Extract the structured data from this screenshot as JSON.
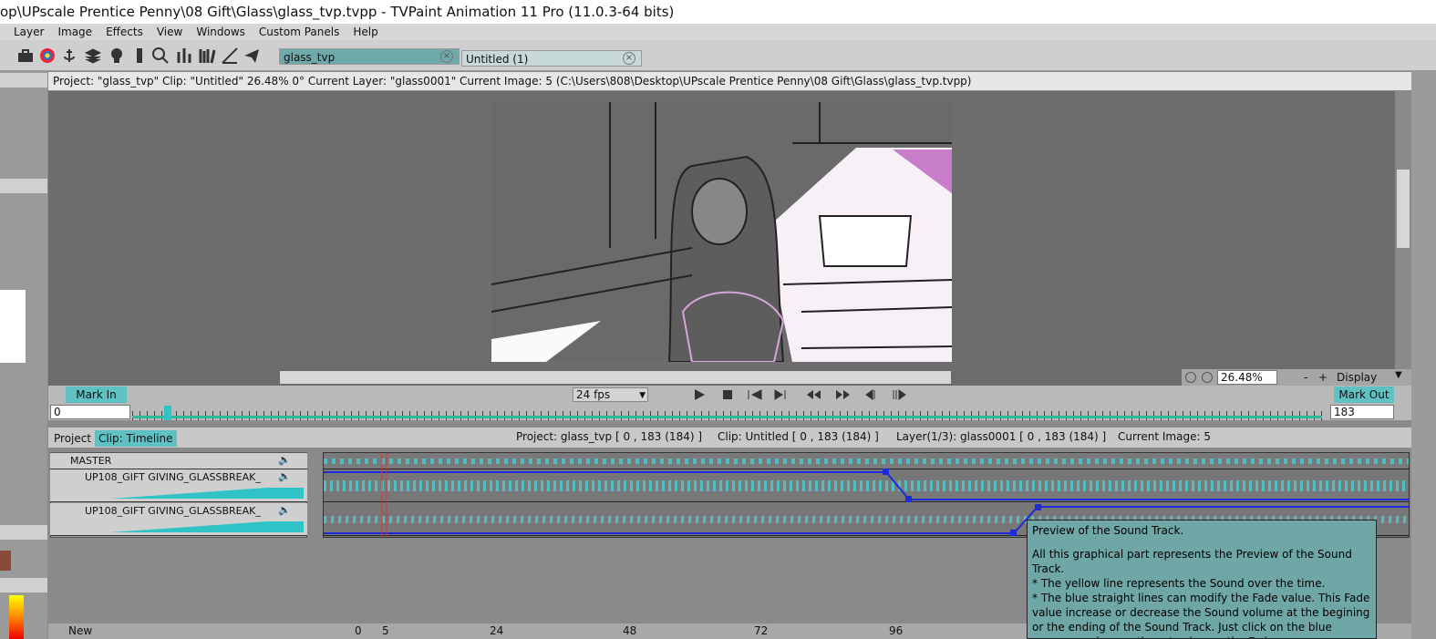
{
  "window": {
    "title": "op\\UPscale Prentice Penny\\08 Gift\\Glass\\glass_tvp.tvpp - TVPaint Animation 11 Pro (11.0.3-64 bits)"
  },
  "menu": [
    "Layer",
    "Image",
    "Effects",
    "View",
    "Windows",
    "Custom Panels",
    "Help"
  ],
  "tabs": [
    {
      "label": "glass_tvp",
      "close": "×"
    },
    {
      "label": "Untitled (1)",
      "close": "×"
    }
  ],
  "project_panel": {
    "header": "Project:  \"glass_tvp\"  Clip: \"Untitled\"   26.48%   0°  Current Layer: \"glass0001\"  Current Image: 5 (C:\\Users\\808\\Desktop\\UPscale Prentice Penny\\08 Gift\\Glass\\glass_tvp.tvpp)",
    "zoom_value": "26.48%",
    "display_label": "Display",
    "zoom_minus": "-",
    "zoom_plus": "+"
  },
  "playback": {
    "mark_in": "Mark In",
    "mark_out": "Mark Out",
    "fps": "24 fps",
    "start_field": "0",
    "end_field": "183"
  },
  "timeline": {
    "tab_project": "Project",
    "tab_clip": "Clip: Timeline",
    "info_project": "Project: glass_tvp [ 0 , 183  (184) ]",
    "info_clip": "Clip: Untitled [ 0 , 183  (184) ]",
    "info_layer": "Layer(1/3): glass0001 [ 0 , 183  (184) ]",
    "info_image": "Current Image: 5",
    "tracks": [
      {
        "name": "MASTER"
      },
      {
        "name": "UP108_GIFT GIVING_GLASSBREAK_"
      },
      {
        "name": "UP108_GIFT GIVING_GLASSBREAK_"
      }
    ],
    "ruler_labels": [
      "0",
      "5",
      "24",
      "48",
      "72",
      "96"
    ],
    "new_label": "New"
  },
  "tooltip": {
    "title": "Preview of the Sound Track.",
    "lines": [
      "All this graphical part represents the Preview of the Sound Track.",
      "* The yellow line represents the Sound over the time.",
      "* The blue straight lines can modify the Fade value. This Fade value increase or decrease the Sound volume at the begining or the ending of the Sound Track. Just click on the blue squares and move them to change the Fade."
    ]
  },
  "colors": {
    "accent": "#5fc1c4",
    "wave": "#4fbfc2",
    "fade_line": "#1f2bd6"
  }
}
